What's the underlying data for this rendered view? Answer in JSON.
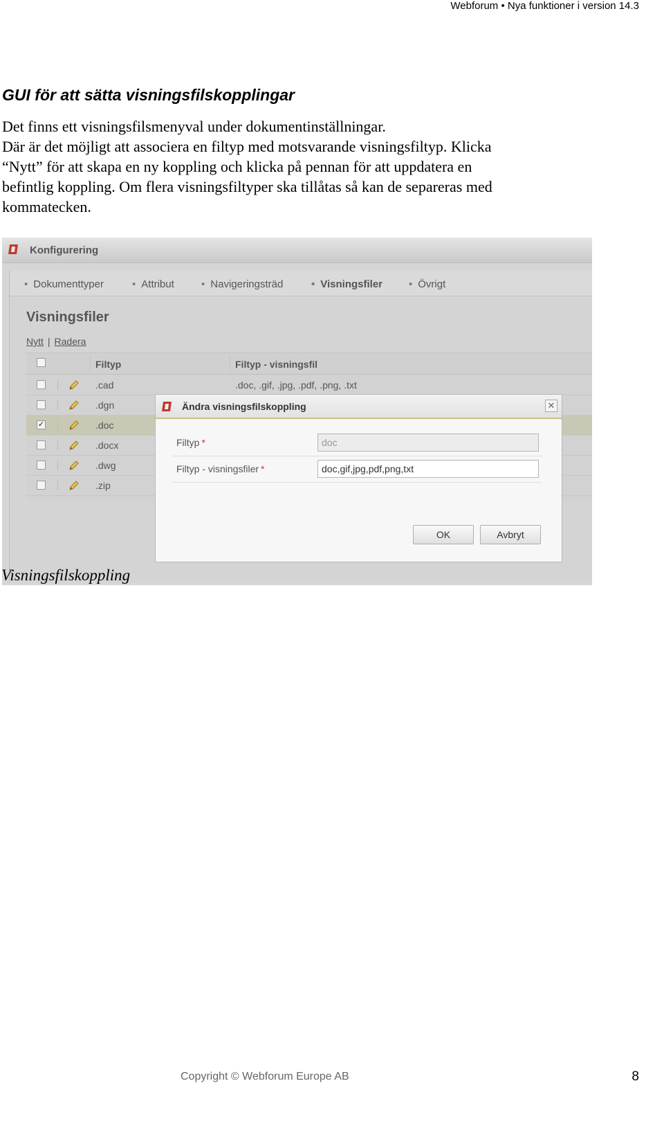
{
  "header": {
    "text": "Webforum • Nya funktioner i version 14.3"
  },
  "section": {
    "title": "GUI för att sätta visningsfilskopplingar",
    "lines": [
      "Det finns ett visningsfilsmenyval under dokumentinställningar.",
      "Där är det möjligt att associera en filtyp med motsvarande visningsfiltyp. Klicka",
      "“Nytt” för att skapa en ny koppling och klicka på pennan för att uppdatera en",
      "befintlig koppling. Om flera visningsfiltyper ska tillåtas så kan de separeras med",
      "kommatecken."
    ]
  },
  "screenshot": {
    "app_title": "Konfigurering",
    "tabs": [
      {
        "label": "Dokumenttyper",
        "active": false
      },
      {
        "label": "Attribut",
        "active": false
      },
      {
        "label": "Navigeringsträd",
        "active": false
      },
      {
        "label": "Visningsfiler",
        "active": true
      },
      {
        "label": "Övrigt",
        "active": false
      }
    ],
    "panel_title": "Visningsfiler",
    "actions": {
      "new": "Nytt",
      "separator": "|",
      "delete": "Radera"
    },
    "grid": {
      "columns": [
        "Filtyp",
        "Filtyp - visningsfil"
      ],
      "rows": [
        {
          "filtyp": ".cad",
          "visningsfil": ".doc, .gif, .jpg, .pdf, .png, .txt",
          "checked": false
        },
        {
          "filtyp": ".dgn",
          "visningsfil": "",
          "checked": false
        },
        {
          "filtyp": ".doc",
          "visningsfil": "",
          "checked": true
        },
        {
          "filtyp": ".docx",
          "visningsfil": "",
          "checked": false
        },
        {
          "filtyp": ".dwg",
          "visningsfil": "",
          "checked": false
        },
        {
          "filtyp": ".zip",
          "visningsfil": "",
          "checked": false
        }
      ]
    },
    "dialog": {
      "title": "Ändra visningsfilskoppling",
      "close_icon": "close-icon",
      "fields": [
        {
          "label": "Filtyp",
          "required_mark": "*",
          "value": "doc"
        },
        {
          "label": "Filtyp - visningsfiler",
          "required_mark": "*",
          "value": "doc,gif,jpg,pdf,png,txt"
        }
      ],
      "ok_label": "OK",
      "cancel_label": "Avbryt"
    },
    "colors": {
      "brand_red": "#c0392b",
      "selected_row": "#c8c8b4"
    }
  },
  "caption": "Visningsfilskoppling",
  "footer": {
    "copyright": "Copyright © Webforum Europe AB",
    "page_number": "8"
  }
}
